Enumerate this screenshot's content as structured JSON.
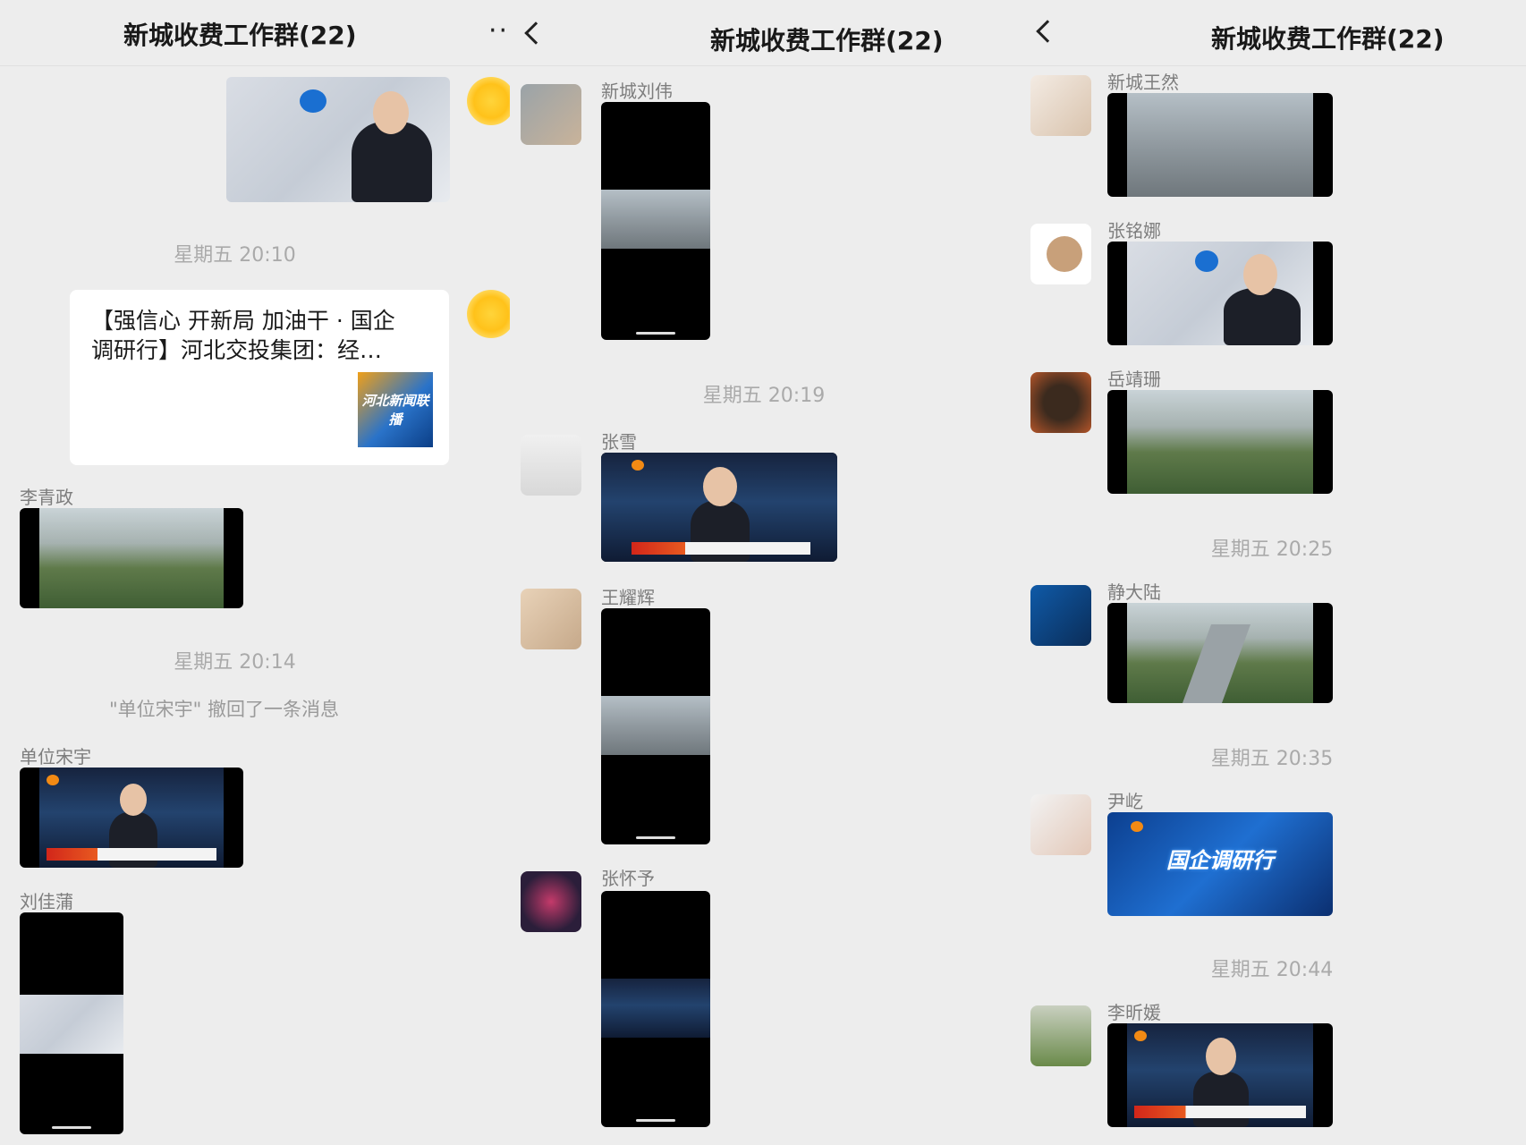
{
  "panel1": {
    "title": "新城收费工作群(22)",
    "time1": "星期五 20:10",
    "card_text": "【强信心 开新局 加油干 · 国企调研行】河北交投集团：经…",
    "card_thumb": "河北新闻联播",
    "sender1": "李青政",
    "time2": "星期五 20:14",
    "recall": "\"单位宋宇\" 撤回了一条消息",
    "sender2": "单位宋宇",
    "sender3": "刘佳蒲"
  },
  "panel2": {
    "title": "新城收费工作群(22)",
    "sender1": "新城刘伟",
    "time1": "星期五 20:19",
    "sender2": "张雪",
    "sender3": "王耀辉",
    "sender4": "张怀予"
  },
  "panel3": {
    "title": "新城收费工作群(22)",
    "sender1": "新城王然",
    "sender2": "张铭娜",
    "sender3": "岳靖珊",
    "time1": "星期五 20:25",
    "sender4": "静大陆",
    "time2": "星期五 20:35",
    "sender5": "尹屹",
    "video5_text": "国企调研行",
    "time3": "星期五 20:44",
    "sender6": "李昕媛"
  },
  "icons": [
    "back-icon",
    "more-icon",
    "video-thumbnail",
    "avatar"
  ],
  "colors": {
    "background": "#ededed",
    "bubble": "#ffffff",
    "timestamp": "#aaaaaa",
    "name": "#7d7d7d"
  }
}
